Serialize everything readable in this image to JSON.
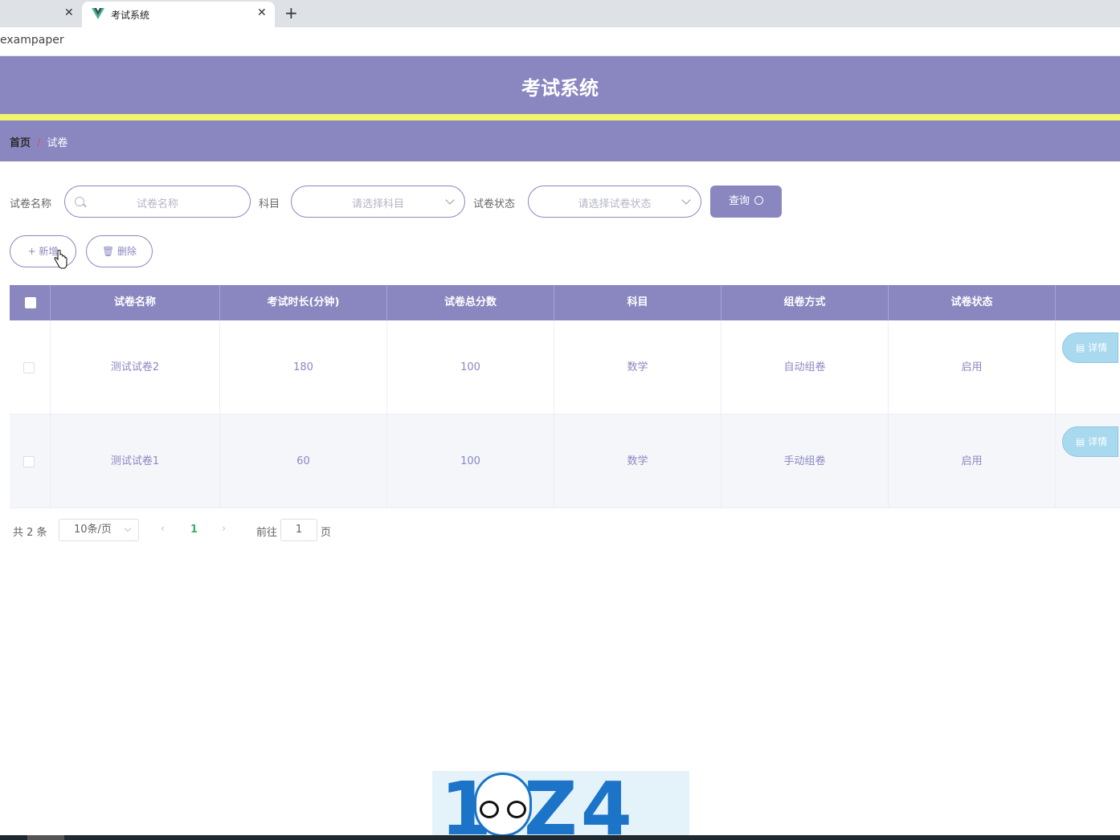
{
  "browser": {
    "active_tab_title": "考试系统",
    "url": "exampaper"
  },
  "header": {
    "title": "考试系统"
  },
  "breadcrumb": {
    "home": "首页",
    "separator": "/",
    "current": "试卷"
  },
  "search": {
    "name_label": "试卷名称",
    "name_placeholder": "试卷名称",
    "subject_label": "科目",
    "subject_placeholder": "请选择科目",
    "status_label": "试卷状态",
    "status_placeholder": "请选择试卷状态",
    "query_label": "查询"
  },
  "actions": {
    "add_label": "+ 新增",
    "delete_label": "删除"
  },
  "table": {
    "columns": [
      "试卷名称",
      "考试时长(分钟)",
      "试卷总分数",
      "科目",
      "组卷方式",
      "试卷状态"
    ],
    "rows": [
      {
        "name": "测试试卷2",
        "duration": "180",
        "total": "100",
        "subject": "数学",
        "method": "自动组卷",
        "status": "启用",
        "detail": "详情"
      },
      {
        "name": "测试试卷1",
        "duration": "60",
        "total": "100",
        "subject": "数学",
        "method": "手动组卷",
        "status": "启用",
        "detail": "详情"
      }
    ]
  },
  "pagination": {
    "total_text": "共 2 条",
    "page_size": "10条/页",
    "current_page": "1",
    "goto_label": "前往",
    "goto_value": "1",
    "page_unit": "页"
  },
  "watermark": {
    "text": "1 Z4"
  },
  "colors": {
    "primary": "#8a87c0",
    "accent_yellow": "#f2f46b",
    "detail_button": "#a8d9ef",
    "page_active": "#3aaf6f"
  }
}
